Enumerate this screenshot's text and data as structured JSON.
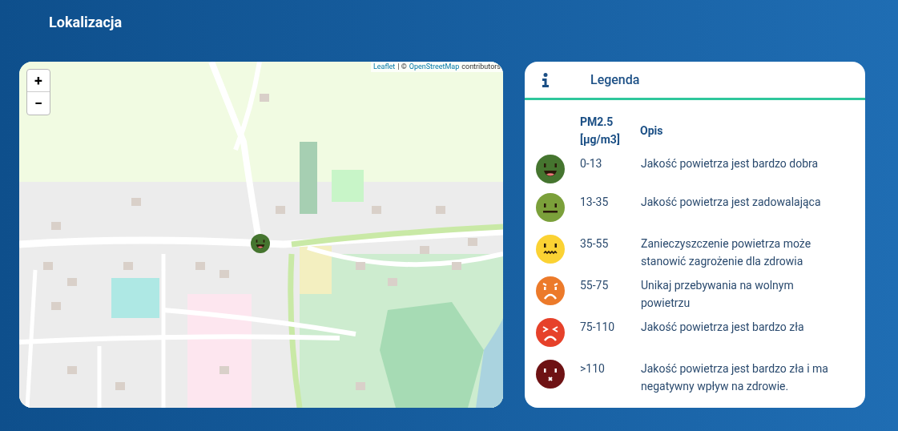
{
  "page": {
    "title": "Lokalizacja"
  },
  "map": {
    "zoom_controls": [
      {
        "label": "+"
      },
      {
        "label": "−"
      }
    ],
    "attribution": [
      {
        "kind": "link",
        "text": "Leaflet"
      },
      {
        "kind": "text",
        "text": "| ©"
      },
      {
        "kind": "link",
        "text": "OpenStreetMap"
      },
      {
        "kind": "text",
        "text": "contributors"
      }
    ],
    "marker": {
      "kind": "smile",
      "color": "#45752f"
    }
  },
  "legend": {
    "title": "Legenda",
    "columns": [
      "PM2.5 [µg/m3]",
      "Opis"
    ],
    "rows": [
      {
        "kind": "smile",
        "color": "#45752f",
        "range": "0-13",
        "description": "Jakość powietrza jest bardzo dobra"
      },
      {
        "kind": "neutral",
        "color": "#7ba03a",
        "range": "13-35",
        "description": "Jakość powietrza jest zadowalająca"
      },
      {
        "kind": "wavy",
        "color": "#fbd233",
        "range": "35-55",
        "description": "Zanieczyszczenie powietrza może stanowić zagrożenie dla zdrowia"
      },
      {
        "kind": "sad",
        "color": "#ec7a2a",
        "range": "55-75",
        "description": "Unikaj przebywania na wolnym powietrzu"
      },
      {
        "kind": "angry",
        "color": "#e6412a",
        "range": "75-110",
        "description": "Jakość powietrza jest bardzo zła"
      },
      {
        "kind": "dead",
        "color": "#6e1214",
        "range": ">110",
        "description": "Jakość powietrza jest bardzo zła i ma negatywny wpływ na zdrowie."
      }
    ]
  }
}
